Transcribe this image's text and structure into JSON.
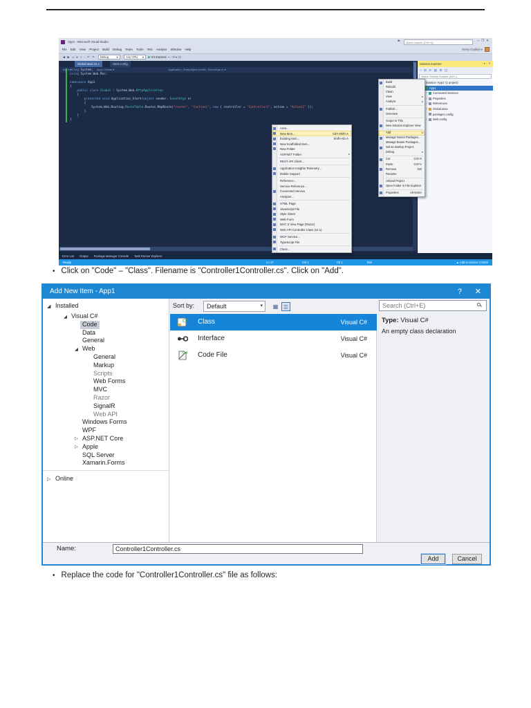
{
  "page": {
    "bullet1": "Click on \"Code\" – \"Class\". Filename is \"Controller1Controller.cs\". Click on \"Add\".",
    "bullet2": "Replace the code for \"Controller1Controller.cs\" file as follows:"
  },
  "vs": {
    "title": "App1 - Microsoft Visual Studio",
    "quick_launch_placeholder": "Quick Launch (Ctrl+Q)",
    "user": "Henry Gudkov ▾",
    "menus": [
      "File",
      "Edit",
      "View",
      "Project",
      "Build",
      "Debug",
      "Team",
      "Tools",
      "Test",
      "Analyze",
      "Window",
      "Help"
    ],
    "toolbar": {
      "config": "Debug",
      "platform": "Any CPU",
      "run": "IIS Express"
    },
    "toolbar_icons": [
      "back",
      "forward",
      "new-file",
      "open-file",
      "save",
      "save-all",
      "undo",
      "redo"
    ],
    "tabs": [
      {
        "label": "Global.asax.cs",
        "active": true
      },
      {
        "label": "Web.config",
        "active": false
      }
    ],
    "breadcrumb": [
      "App1",
      "App1.Global",
      "Application_Start(object sender, EventArgs e)"
    ],
    "code": [
      [
        [
          "k",
          "using"
        ],
        [
          "p",
          " System;"
        ]
      ],
      [
        [
          "k",
          "using"
        ],
        [
          "p",
          " System.Web.Mvc;"
        ]
      ],
      [],
      [
        [
          "k",
          "namespace"
        ],
        [
          "p",
          " App1"
        ]
      ],
      [
        [
          "p",
          "{"
        ]
      ],
      [
        [
          "p",
          "    "
        ],
        [
          "k",
          "public class "
        ],
        [
          "t",
          "Global"
        ],
        [
          "p",
          " : System.Web."
        ],
        [
          "t",
          "HttpApplication"
        ]
      ],
      [
        [
          "p",
          "    {"
        ]
      ],
      [
        [
          "p",
          "        "
        ],
        [
          "k",
          "protected void"
        ],
        [
          "p",
          " Application_Start("
        ],
        [
          "k",
          "object"
        ],
        [
          "p",
          " sender, "
        ],
        [
          "t",
          "EventArgs"
        ],
        [
          "p",
          " e)"
        ]
      ],
      [
        [
          "p",
          "        {"
        ]
      ],
      [
        [
          "p",
          "            System.Web.Routing."
        ],
        [
          "t",
          "RouteTable"
        ],
        [
          "p",
          ".Routes.MapRoute("
        ],
        [
          "s",
          "\"router\""
        ],
        [
          "p",
          ", "
        ],
        [
          "s",
          "\"{action}\""
        ],
        [
          "p",
          ", "
        ],
        [
          "k",
          "new"
        ],
        [
          "p",
          " { controller = "
        ],
        [
          "s",
          "\"Controller1\""
        ],
        [
          "p",
          ", action = "
        ],
        [
          "s",
          "\"Action1\""
        ],
        [
          "p",
          " });"
        ]
      ],
      [
        [
          "p",
          "        }"
        ]
      ],
      [
        [
          "p",
          "    }"
        ]
      ],
      [
        [
          "p",
          "}"
        ]
      ]
    ],
    "solution_explorer": {
      "title": "Solution Explorer",
      "toolbar_icons": [
        "home",
        "collapse-all",
        "sync",
        "show-all-files",
        "properties",
        "preview"
      ],
      "search_placeholder": "Search Solution Explorer (Ctrl+;)",
      "items": [
        {
          "label": "Solution 'App1' (1 project)",
          "indent": 0,
          "icon": "solution"
        },
        {
          "label": "App1",
          "indent": 1,
          "icon": "project",
          "selected": true
        },
        {
          "label": "Connected Services",
          "indent": 2,
          "icon": "connected-services",
          "expander": "collapsed"
        },
        {
          "label": "Properties",
          "indent": 2,
          "icon": "properties",
          "expander": "collapsed"
        },
        {
          "label": "References",
          "indent": 2,
          "icon": "references",
          "expander": "collapsed"
        },
        {
          "label": "Global.asax",
          "indent": 2,
          "icon": "asax",
          "expander": "collapsed"
        },
        {
          "label": "packages.config",
          "indent": 2,
          "icon": "config"
        },
        {
          "label": "Web.config",
          "indent": 2,
          "icon": "config",
          "expander": "collapsed"
        }
      ]
    },
    "panel_tabs": [
      "Error List",
      "Output",
      "Package Manager Console",
      "Task Runner Explorer"
    ],
    "status": {
      "left": "Ready",
      "ln": "Ln 17",
      "col": "Col 1",
      "ch": "Ch 1",
      "mode": "INS",
      "right": "▲ Add to Source Control"
    },
    "context_menu": [
      {
        "label": "Build",
        "icon": true
      },
      {
        "label": "Rebuild"
      },
      {
        "label": "Clean"
      },
      {
        "label": "View",
        "sub": true
      },
      {
        "label": "Analyze",
        "sub": true
      },
      {
        "sep": true
      },
      {
        "label": "Publish...",
        "icon": true
      },
      {
        "label": "Overview"
      },
      {
        "sep": true
      },
      {
        "label": "Scope to This"
      },
      {
        "label": "New Solution Explorer View",
        "icon": true
      },
      {
        "sep": true
      },
      {
        "label": "Add",
        "sub": true,
        "highlight": true
      },
      {
        "label": "Manage NuGet Packages...",
        "icon": true
      },
      {
        "label": "Manage Bower Packages..."
      },
      {
        "label": "Set as StartUp Project",
        "icon": true
      },
      {
        "label": "Debug",
        "sub": true
      },
      {
        "sep": true
      },
      {
        "label": "Cut",
        "shortcut": "Ctrl+X",
        "icon": true
      },
      {
        "label": "Paste",
        "shortcut": "Ctrl+V"
      },
      {
        "label": "Remove",
        "shortcut": "Del",
        "icon": true
      },
      {
        "label": "Rename"
      },
      {
        "sep": true
      },
      {
        "label": "Unload Project"
      },
      {
        "label": "Open Folder in File Explorer",
        "icon": true
      },
      {
        "sep": true
      },
      {
        "label": "Properties",
        "shortcut": "Alt+Enter",
        "icon": true
      }
    ],
    "add_submenu": [
      {
        "label": "Area...",
        "icon": true
      },
      {
        "label": "New Item...",
        "shortcut": "Ctrl+Shift+A",
        "icon": true,
        "highlight": true
      },
      {
        "label": "Existing Item...",
        "shortcut": "Shift+Alt+A",
        "icon": true
      },
      {
        "label": "New Scaffolded Item...",
        "icon": true
      },
      {
        "label": "New Folder",
        "icon": true
      },
      {
        "label": "ASP.NET Folder",
        "sub": true
      },
      {
        "sep": true
      },
      {
        "label": "REST API Client..."
      },
      {
        "sep": true
      },
      {
        "label": "Application Insights Telemetry...",
        "icon": true
      },
      {
        "label": "Mobile Support",
        "icon": true
      },
      {
        "sep": true
      },
      {
        "label": "Reference..."
      },
      {
        "label": "Service Reference..."
      },
      {
        "label": "Connected Service",
        "icon": true
      },
      {
        "label": "Analyzer..."
      },
      {
        "sep": true
      },
      {
        "label": "HTML Page",
        "icon": true
      },
      {
        "label": "JavaScript File",
        "icon": true
      },
      {
        "label": "Style Sheet",
        "icon": true
      },
      {
        "label": "Web Form",
        "icon": true
      },
      {
        "label": "MVC 5 View Page (Razor)",
        "icon": true
      },
      {
        "label": "Web API Controller Class (v2.1)",
        "icon": true
      },
      {
        "sep": true
      },
      {
        "label": "WCF Service...",
        "icon": true
      },
      {
        "label": "TypeScript File",
        "icon": true
      },
      {
        "sep": true
      },
      {
        "label": "Class...",
        "icon": true
      }
    ]
  },
  "dialog": {
    "title": "Add New Item - App1",
    "help_icon": "?",
    "close_icon": "✕",
    "installed_label": "Installed",
    "online_label": "Online",
    "sort_by_label": "Sort by:",
    "sort_value": "Default",
    "search_placeholder": "Search (Ctrl+E)",
    "tree": [
      {
        "label": "Visual C#",
        "indent": 0,
        "expander": "expanded"
      },
      {
        "label": "Code",
        "indent": 1,
        "selected": true
      },
      {
        "label": "Data",
        "indent": 1
      },
      {
        "label": "General",
        "indent": 1
      },
      {
        "label": "Web",
        "indent": 1,
        "expander": "expanded"
      },
      {
        "label": "General",
        "indent": 2
      },
      {
        "label": "Markup",
        "indent": 2
      },
      {
        "label": "Scripts",
        "indent": 2,
        "dim": true
      },
      {
        "label": "Web Forms",
        "indent": 2
      },
      {
        "label": "MVC",
        "indent": 2
      },
      {
        "label": "Razor",
        "indent": 2,
        "dim": true
      },
      {
        "label": "SignalR",
        "indent": 2
      },
      {
        "label": "Web API",
        "indent": 2,
        "dim": true
      },
      {
        "label": "Windows Forms",
        "indent": 1
      },
      {
        "label": "WPF",
        "indent": 1
      },
      {
        "label": "ASP.NET Core",
        "indent": 1,
        "expander": "collapsed"
      },
      {
        "label": "Apple",
        "indent": 1,
        "expander": "collapsed"
      },
      {
        "label": "SQL Server",
        "indent": 1
      },
      {
        "label": "Xamarin.Forms",
        "indent": 1
      }
    ],
    "templates": [
      {
        "name": "Class",
        "lang": "Visual C#",
        "icon": "class",
        "selected": true
      },
      {
        "name": "Interface",
        "lang": "Visual C#",
        "icon": "interface"
      },
      {
        "name": "Code File",
        "lang": "Visual C#",
        "icon": "code-file"
      }
    ],
    "type_label": "Type:",
    "type_value": "Visual C#",
    "description": "An empty class declaration",
    "name_label": "Name:",
    "name_value": "Controller1Controller.cs",
    "add_label": "Add",
    "cancel_label": "Cancel"
  }
}
